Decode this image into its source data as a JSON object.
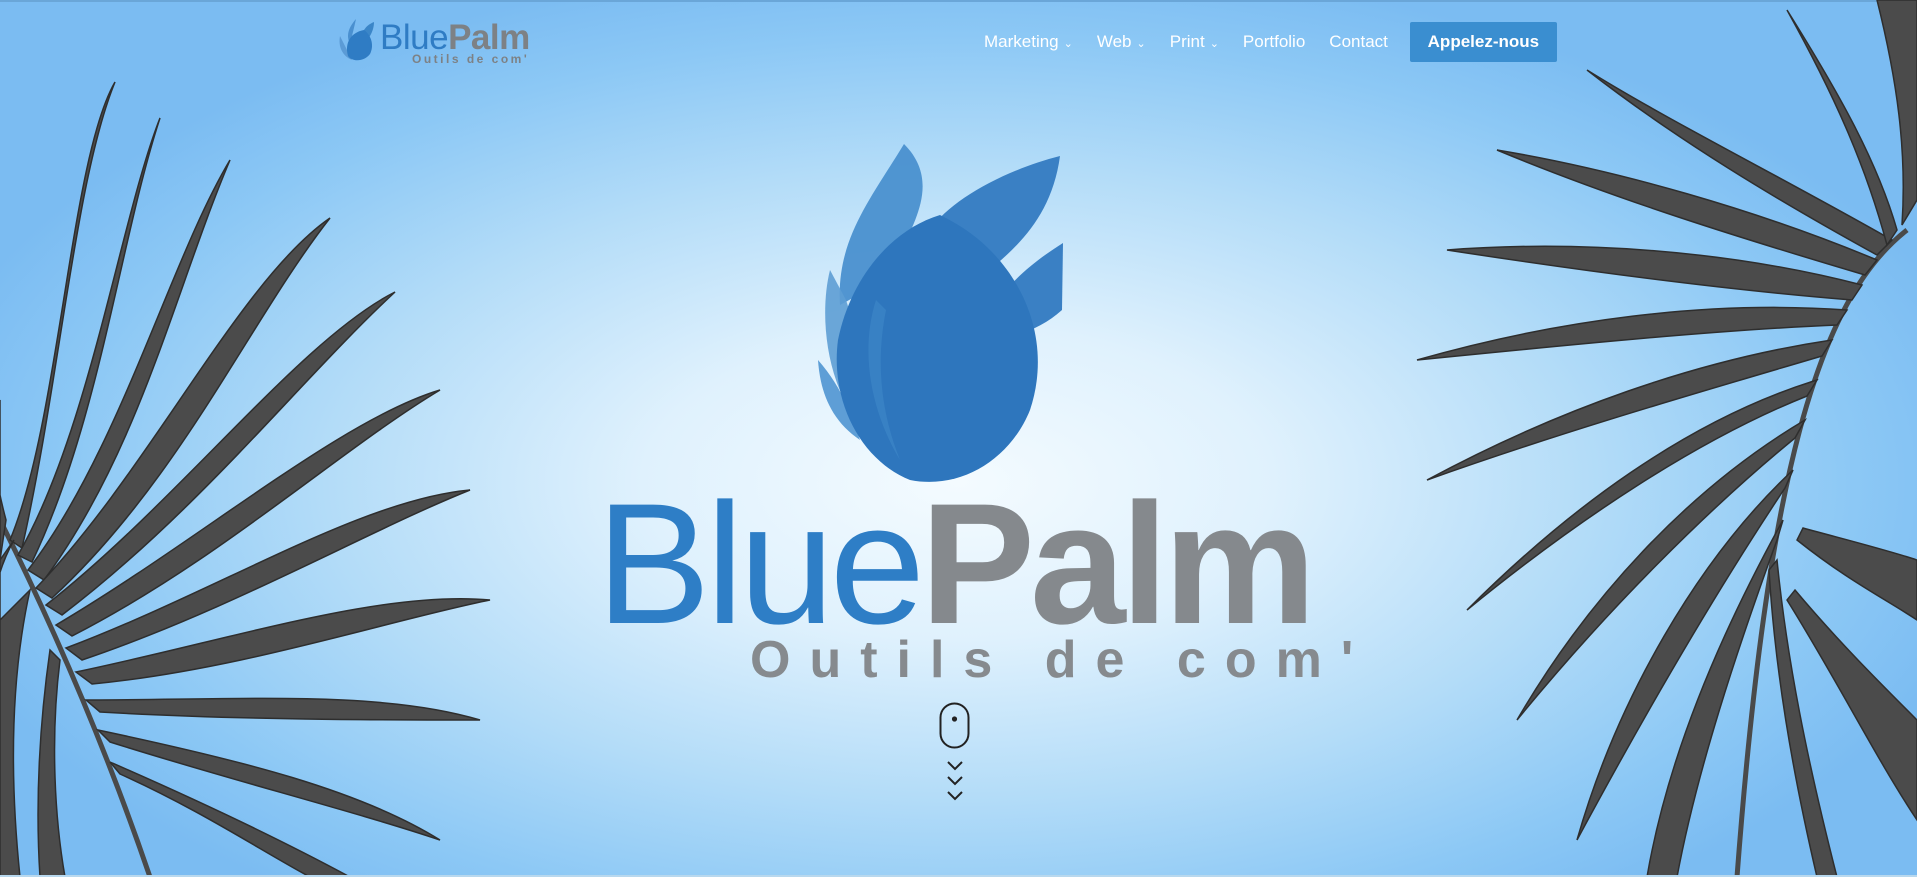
{
  "brand": {
    "name_part1": "Blue",
    "name_part2": "Palm",
    "tagline": "Outils de com'"
  },
  "nav": {
    "items": [
      {
        "label": "Marketing",
        "has_dropdown": true
      },
      {
        "label": "Web",
        "has_dropdown": true
      },
      {
        "label": "Print",
        "has_dropdown": true
      },
      {
        "label": "Portfolio",
        "has_dropdown": false
      },
      {
        "label": "Contact",
        "has_dropdown": false
      }
    ],
    "dropdown_glyph": "⌄",
    "cta_label": "Appelez-nous"
  },
  "hero": {
    "title_part1": "Blue",
    "title_part2": "Palm",
    "subtitle": "Outils de com'"
  },
  "icons": [
    "palm-leaf-logo-icon",
    "mouse-icon",
    "chevron-down-icon",
    "palm-frond-icon"
  ],
  "colors": {
    "brand_blue": "#2e7ec6",
    "brand_gray": "#85898d",
    "cta_background": "#3a8ed0",
    "nav_text": "#ffffff",
    "sky_light": "#f4fbff",
    "sky_dark": "#7bbcf2"
  }
}
